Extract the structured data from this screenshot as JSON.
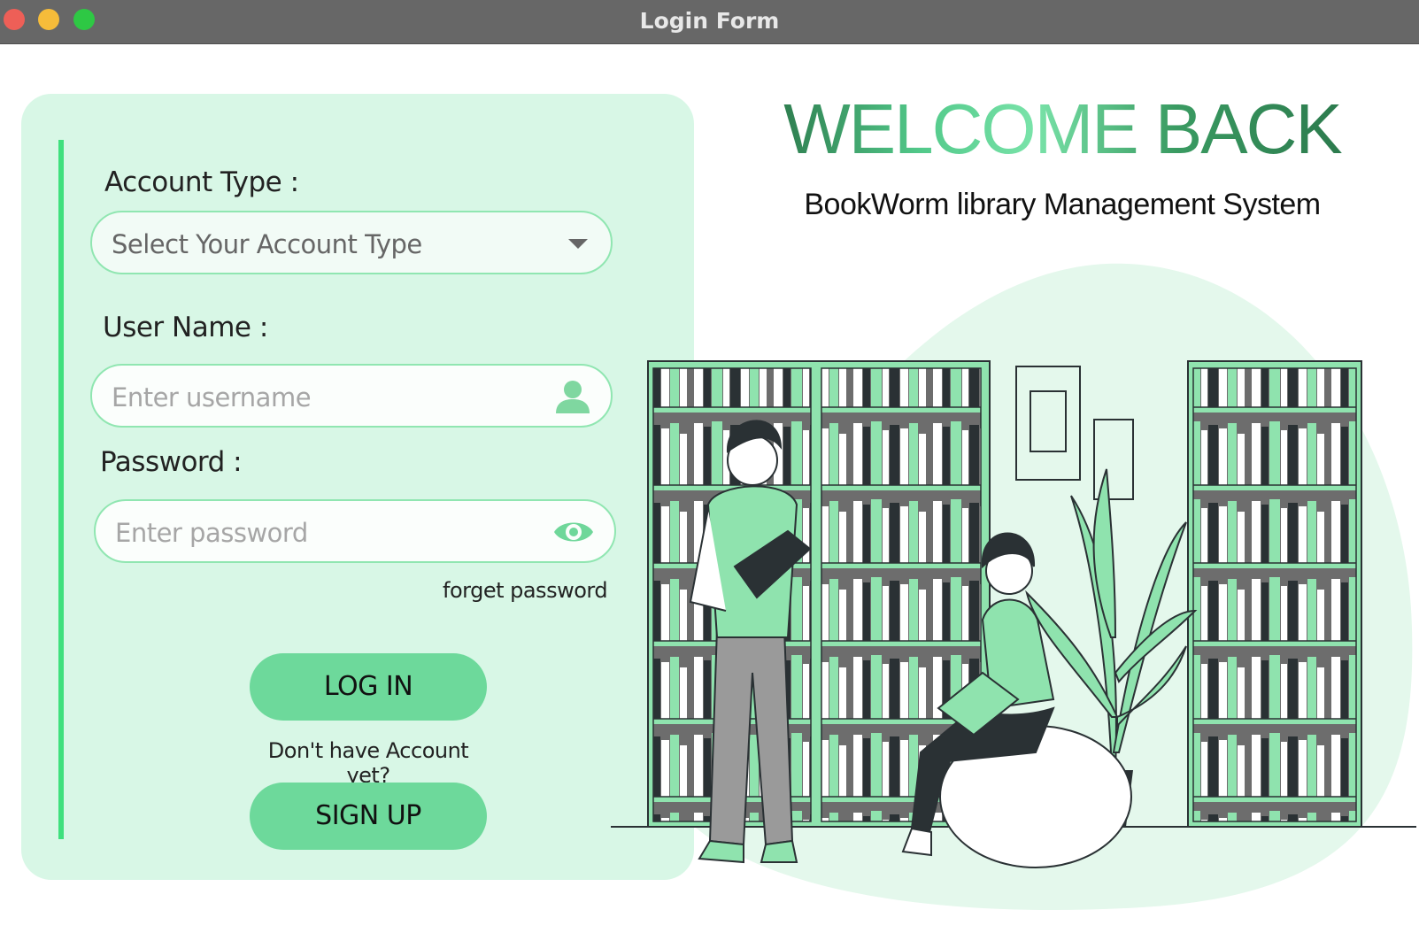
{
  "window": {
    "title": "Login Form"
  },
  "form": {
    "account_type": {
      "label": "Account Type :",
      "selected": "Select Your Account Type"
    },
    "username": {
      "label": "User Name :",
      "placeholder": "Enter username",
      "value": ""
    },
    "password": {
      "label": "Password :",
      "placeholder": "Enter password",
      "value": ""
    },
    "forget_link": "forget password",
    "login_label": "LOG IN",
    "no_account_text": "Don't have Account yet?",
    "signup_label": "SIGN UP"
  },
  "hero": {
    "heading": "WELCOME BACK",
    "subtitle": "BookWorm library Management System"
  },
  "colors": {
    "accent": "#3fe07d",
    "button": "#6dd99b",
    "panel": "#d8f7e6",
    "field_border": "#90e6b1"
  }
}
